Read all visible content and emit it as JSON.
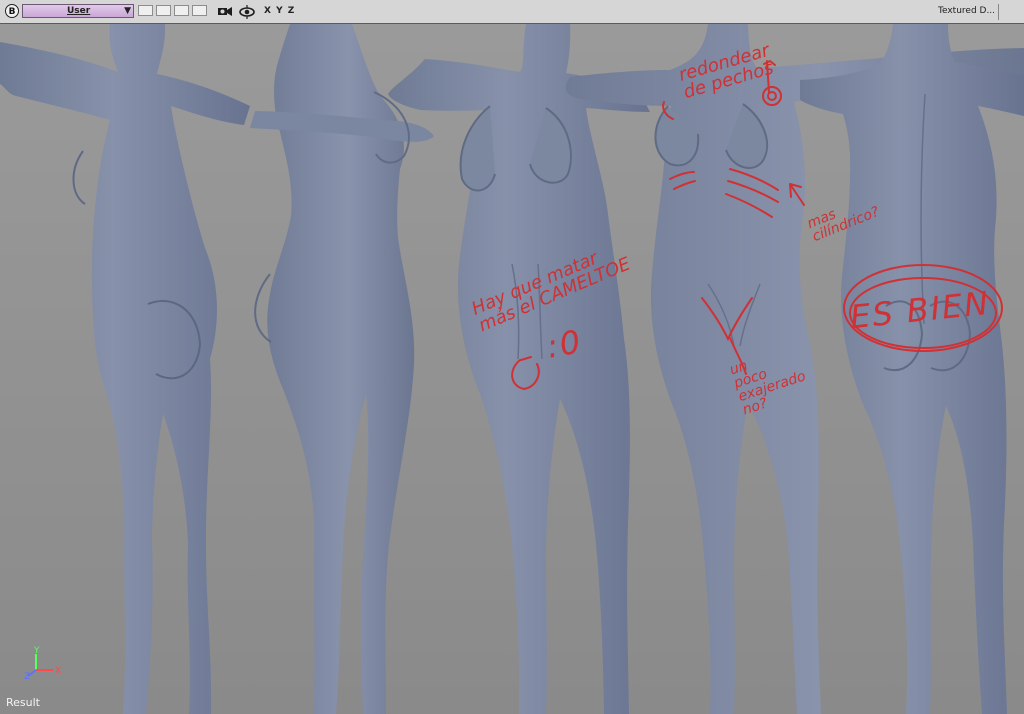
{
  "toolbar": {
    "badge": "B",
    "view_select": "User",
    "dropdown_arrow": "▼",
    "axis_label": "X Y Z",
    "display_mode": "Textured D..."
  },
  "annotations": [
    "redondear\nde pechos",
    "mas\ncilíndrico?",
    "Hay que matar\nmás el CAMELTOE",
    ":0",
    "un\npoco\nexajerado\nno?",
    "ES BIEN"
  ],
  "viewport": {
    "result_label": "Result",
    "axis_gizmo": {
      "y": "Y",
      "x": "X",
      "z": "Z"
    }
  },
  "colors": {
    "toolbar_bg": "#d6d6d6",
    "selector_bg": "#d2b3de",
    "viewport_bg": "#909090",
    "model": "#7f8aa3",
    "annotation": "#cf3134"
  }
}
